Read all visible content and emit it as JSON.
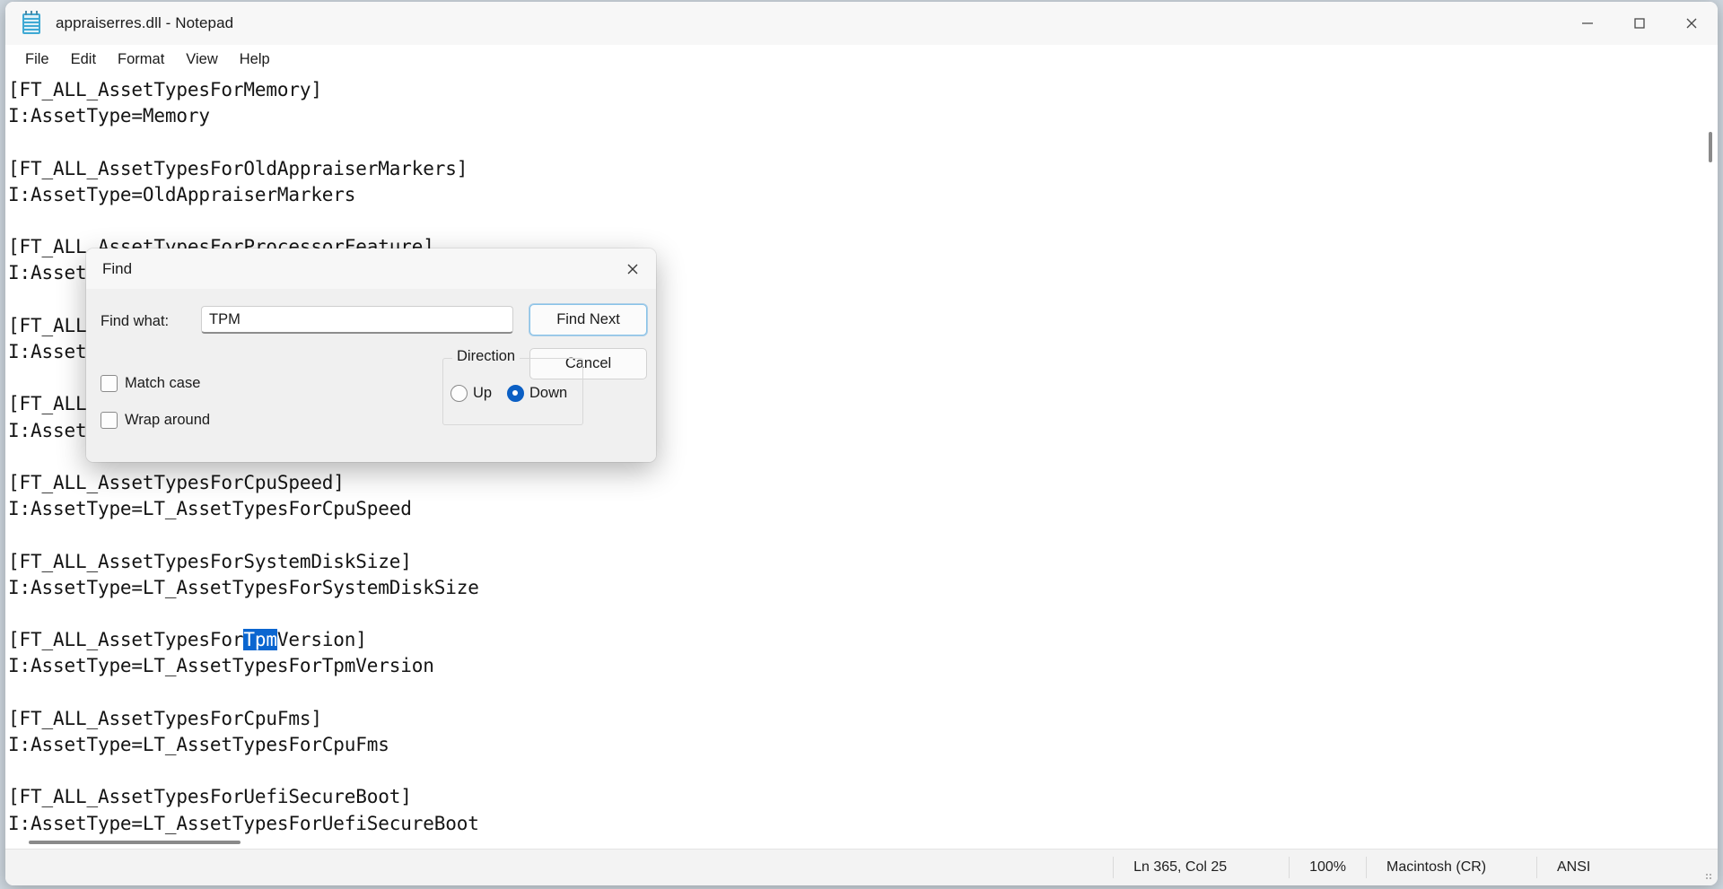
{
  "window": {
    "title": "appraiserres.dll - Notepad",
    "icon": "notepad-icon",
    "controls": {
      "minimize": "─",
      "maximize": "□",
      "close": "✕"
    }
  },
  "menubar": {
    "items": [
      {
        "label": "File"
      },
      {
        "label": "Edit"
      },
      {
        "label": "Format"
      },
      {
        "label": "View"
      },
      {
        "label": "Help"
      }
    ]
  },
  "editor": {
    "lines_before_selection": "[FT_ALL_AssetTypesForMemory]\nI:AssetType=Memory\n\n[FT_ALL_AssetTypesForOldAppraiserMarkers]\nI:AssetType=OldAppraiserMarkers\n\n[FT_ALL_AssetTypesForProcessorFeature]\nI:AssetType=ProcessorFeature\n\n[FT_ALL_AssetTypesForCpuCores]\nI:AssetType=LT_AssetTypesForCpuCores\n\n[FT_ALL_AssetTypesForMemorySize]\nI:AssetType=LT_AssetTypesForMemorySize\n\n[FT_ALL_AssetTypesForCpuSpeed]\nI:AssetType=LT_AssetTypesForCpuSpeed\n\n[FT_ALL_AssetTypesForSystemDiskSize]\nI:AssetType=LT_AssetTypesForSystemDiskSize\n\n[FT_ALL_AssetTypesFor",
    "selected_text": "Tpm",
    "lines_after_selection": "Version]\nI:AssetType=LT_AssetTypesForTpmVersion\n\n[FT_ALL_AssetTypesForCpuFms]\nI:AssetType=LT_AssetTypesForCpuFms\n\n[FT_ALL_AssetTypesForUefiSecureBoot]\nI:AssetType=LT_AssetTypesForUefiSecureBoot",
    "selection_color": "#0b66d0"
  },
  "statusbar": {
    "position": "Ln 365, Col 25",
    "zoom": "100%",
    "line_ending": "Macintosh (CR)",
    "encoding": "ANSI"
  },
  "find_dialog": {
    "title": "Find",
    "close_glyph": "✕",
    "find_what_label": "Find what:",
    "find_what_value": "TPM",
    "find_what_placeholder": "",
    "find_next_label": "Find Next",
    "cancel_label": "Cancel",
    "direction": {
      "legend": "Direction",
      "options": [
        {
          "label": "Up",
          "selected": false
        },
        {
          "label": "Down",
          "selected": true
        }
      ],
      "selected_value": "Down"
    },
    "options": [
      {
        "label": "Match case",
        "checked": false
      },
      {
        "label": "Wrap around",
        "checked": false
      }
    ],
    "accent_color": "#0b5fc4",
    "focus_color": "#88c3e8"
  }
}
